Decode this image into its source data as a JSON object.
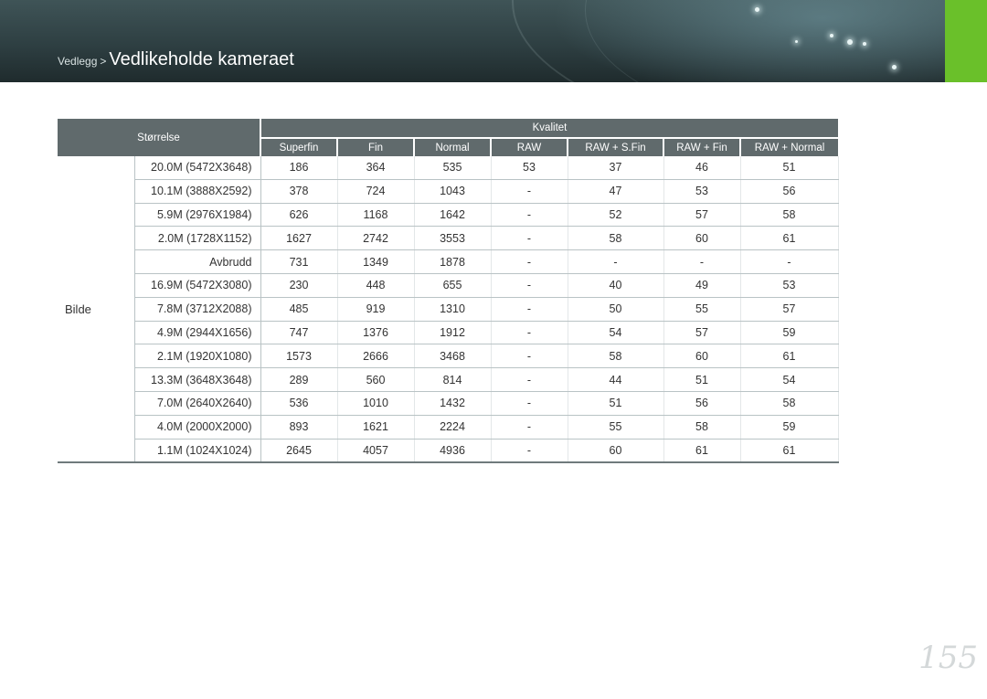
{
  "header": {
    "breadcrumb_parent": "Vedlegg",
    "breadcrumb_sep": ">",
    "breadcrumb_current": "Vedlikeholde kameraet",
    "accent_color": "#6ac02a"
  },
  "table": {
    "size_header": "Størrelse",
    "quality_header": "Kvalitet",
    "columns": [
      "Superfin",
      "Fin",
      "Normal",
      "RAW",
      "RAW + S.Fin",
      "RAW + Fin",
      "RAW + Normal"
    ],
    "category": "Bilde",
    "rows": [
      {
        "size": "20.0M (5472X3648)",
        "values": [
          "186",
          "364",
          "535",
          "53",
          "37",
          "46",
          "51"
        ]
      },
      {
        "size": "10.1M (3888X2592)",
        "values": [
          "378",
          "724",
          "1043",
          "-",
          "47",
          "53",
          "56"
        ]
      },
      {
        "size": "5.9M (2976X1984)",
        "values": [
          "626",
          "1168",
          "1642",
          "-",
          "52",
          "57",
          "58"
        ]
      },
      {
        "size": "2.0M (1728X1152)",
        "values": [
          "1627",
          "2742",
          "3553",
          "-",
          "58",
          "60",
          "61"
        ]
      },
      {
        "size": "Avbrudd",
        "values": [
          "731",
          "1349",
          "1878",
          "-",
          "-",
          "-",
          "-"
        ]
      },
      {
        "size": "16.9M (5472X3080)",
        "values": [
          "230",
          "448",
          "655",
          "-",
          "40",
          "49",
          "53"
        ]
      },
      {
        "size": "7.8M (3712X2088)",
        "values": [
          "485",
          "919",
          "1310",
          "-",
          "50",
          "55",
          "57"
        ]
      },
      {
        "size": "4.9M (2944X1656)",
        "values": [
          "747",
          "1376",
          "1912",
          "-",
          "54",
          "57",
          "59"
        ]
      },
      {
        "size": "2.1M (1920X1080)",
        "values": [
          "1573",
          "2666",
          "3468",
          "-",
          "58",
          "60",
          "61"
        ]
      },
      {
        "size": "13.3M (3648X3648)",
        "values": [
          "289",
          "560",
          "814",
          "-",
          "44",
          "51",
          "54"
        ]
      },
      {
        "size": "7.0M (2640X2640)",
        "values": [
          "536",
          "1010",
          "1432",
          "-",
          "51",
          "56",
          "58"
        ]
      },
      {
        "size": "4.0M (2000X2000)",
        "values": [
          "893",
          "1621",
          "2224",
          "-",
          "55",
          "58",
          "59"
        ]
      },
      {
        "size": "1.1M (1024X1024)",
        "values": [
          "2645",
          "4057",
          "4936",
          "-",
          "60",
          "61",
          "61"
        ]
      }
    ]
  },
  "page_number": "155"
}
